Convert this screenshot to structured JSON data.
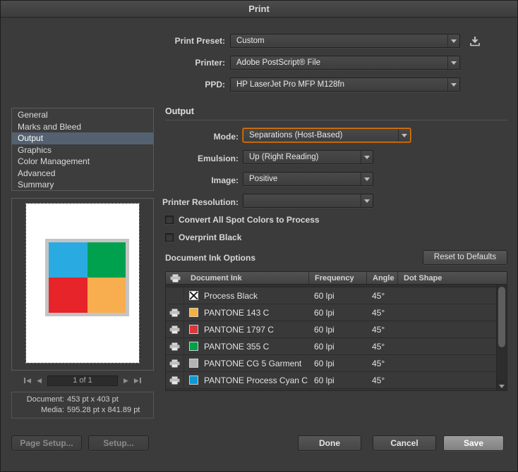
{
  "window": {
    "title": "Print"
  },
  "top": {
    "print_preset": {
      "label": "Print Preset:",
      "value": "Custom"
    },
    "printer": {
      "label": "Printer:",
      "value": "Adobe PostScript® File"
    },
    "ppd": {
      "label": "PPD:",
      "value": "HP LaserJet Pro MFP M128fn"
    }
  },
  "sidebar": {
    "items": [
      {
        "label": "General"
      },
      {
        "label": "Marks and Bleed"
      },
      {
        "label": "Output"
      },
      {
        "label": "Graphics"
      },
      {
        "label": "Color Management"
      },
      {
        "label": "Advanced"
      },
      {
        "label": "Summary"
      }
    ]
  },
  "preview": {
    "page_nav": "1 of 1",
    "document_label": "Document:",
    "document_value": "453 pt x 403 pt",
    "media_label": "Media:",
    "media_value": "595.28 pt x 841.89 pt",
    "artwork_colors": [
      "#29abe2",
      "#00a14e",
      "#e62429",
      "#f8ad4f"
    ]
  },
  "output": {
    "section_title": "Output",
    "mode": {
      "label": "Mode:",
      "value": "Separations (Host-Based)"
    },
    "emulsion": {
      "label": "Emulsion:",
      "value": "Up (Right Reading)"
    },
    "image": {
      "label": "Image:",
      "value": "Positive"
    },
    "printer_resolution": {
      "label": "Printer Resolution:",
      "value": ""
    },
    "convert_spot_label": "Convert All Spot Colors to Process",
    "overprint_black_label": "Overprint Black",
    "ink_options_title": "Document Ink Options",
    "reset_button_label": "Reset to Defaults"
  },
  "ink_table": {
    "headers": {
      "ink": "Document Ink",
      "frequency": "Frequency",
      "angle": "Angle",
      "dot_shape": "Dot Shape"
    },
    "rows": [
      {
        "name": "Process Black",
        "frequency": "60 lpi",
        "angle": "45°",
        "color": "#ffffff",
        "print_enabled": false
      },
      {
        "name": "PANTONE 143 C",
        "frequency": "60 lpi",
        "angle": "45°",
        "color": "#f1b23e",
        "print_enabled": true
      },
      {
        "name": "PANTONE 1797 C",
        "frequency": "60 lpi",
        "angle": "45°",
        "color": "#d8383e",
        "print_enabled": true
      },
      {
        "name": "PANTONE 355 C",
        "frequency": "60 lpi",
        "angle": "45°",
        "color": "#00a046",
        "print_enabled": true
      },
      {
        "name": "PANTONE CG 5 Garment",
        "frequency": "60 lpi",
        "angle": "45°",
        "color": "#b2b4b4",
        "print_enabled": true
      },
      {
        "name": "PANTONE Process Cyan C",
        "frequency": "60 lpi",
        "angle": "45°",
        "color": "#0b99d6",
        "print_enabled": true
      }
    ]
  },
  "footer": {
    "page_setup_label": "Page Setup...",
    "setup_label": "Setup...",
    "done_label": "Done",
    "cancel_label": "Cancel",
    "save_label": "Save"
  }
}
